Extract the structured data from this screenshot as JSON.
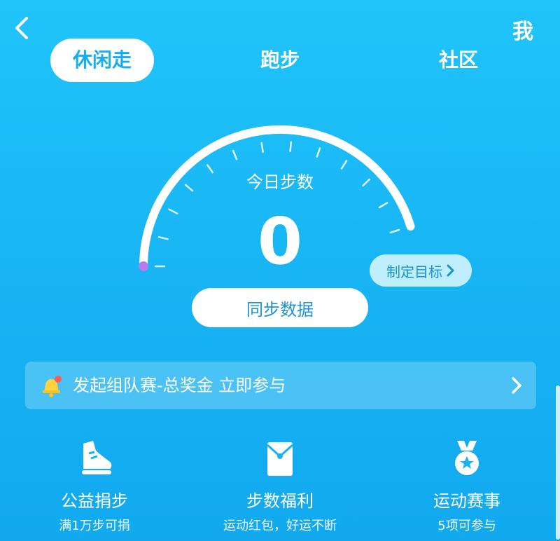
{
  "header": {
    "back_icon": "back-chevron-icon",
    "me_label": "我"
  },
  "tabs": [
    {
      "label": "休闲走",
      "active": true
    },
    {
      "label": "跑步",
      "active": false
    },
    {
      "label": "社区",
      "active": false
    }
  ],
  "gauge": {
    "title": "今日步数",
    "steps": "0"
  },
  "goal_button": {
    "label": "制定目标"
  },
  "sync_button": {
    "label": "同步数据"
  },
  "banner": {
    "text": "发起组队赛-总奖金 立即参与",
    "icon": "bell-icon"
  },
  "features": [
    {
      "name": "公益捐步",
      "sub": "满1万步可捐",
      "icon": "shoe-icon"
    },
    {
      "name": "步数福利",
      "sub": "运动红包，好运不断",
      "icon": "red-envelope-icon"
    },
    {
      "name": "运动赛事",
      "sub": "5项可参与",
      "icon": "medal-icon"
    }
  ],
  "colors": {
    "accent": "#16aef0",
    "progress_dot": "#b57cf0"
  }
}
